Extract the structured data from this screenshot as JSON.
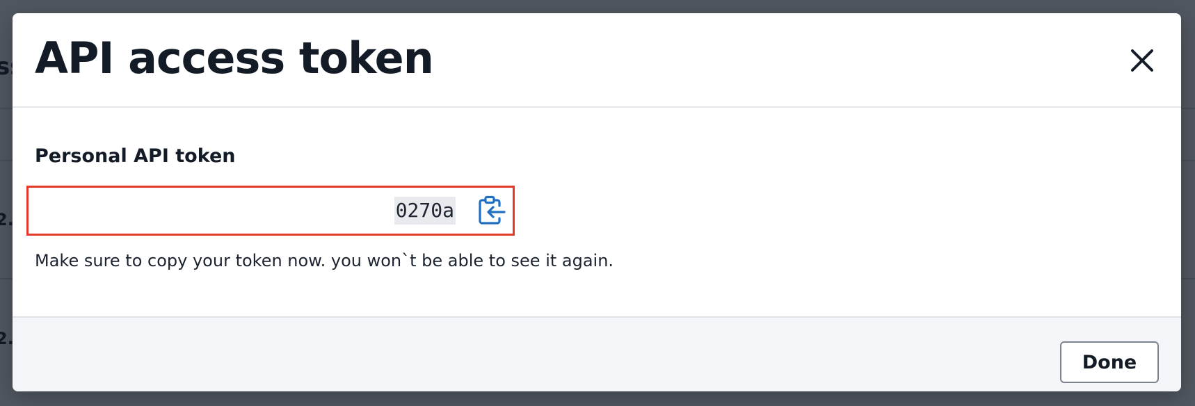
{
  "background": {
    "fragments": [
      "ss",
      "2.",
      "2."
    ]
  },
  "modal": {
    "title": "API access token",
    "close_icon": "close-icon",
    "field_label": "Personal API token",
    "token_value": "0270a",
    "copy_icon": "clipboard-copy-icon",
    "helper_text": "Make sure to copy your token now. you won`t be able to see it again.",
    "done_label": "Done"
  },
  "colors": {
    "accent": "#1f6fc5",
    "highlight_border": "#e4392a",
    "title_text": "#131b26",
    "overlay": "#0e1622"
  }
}
